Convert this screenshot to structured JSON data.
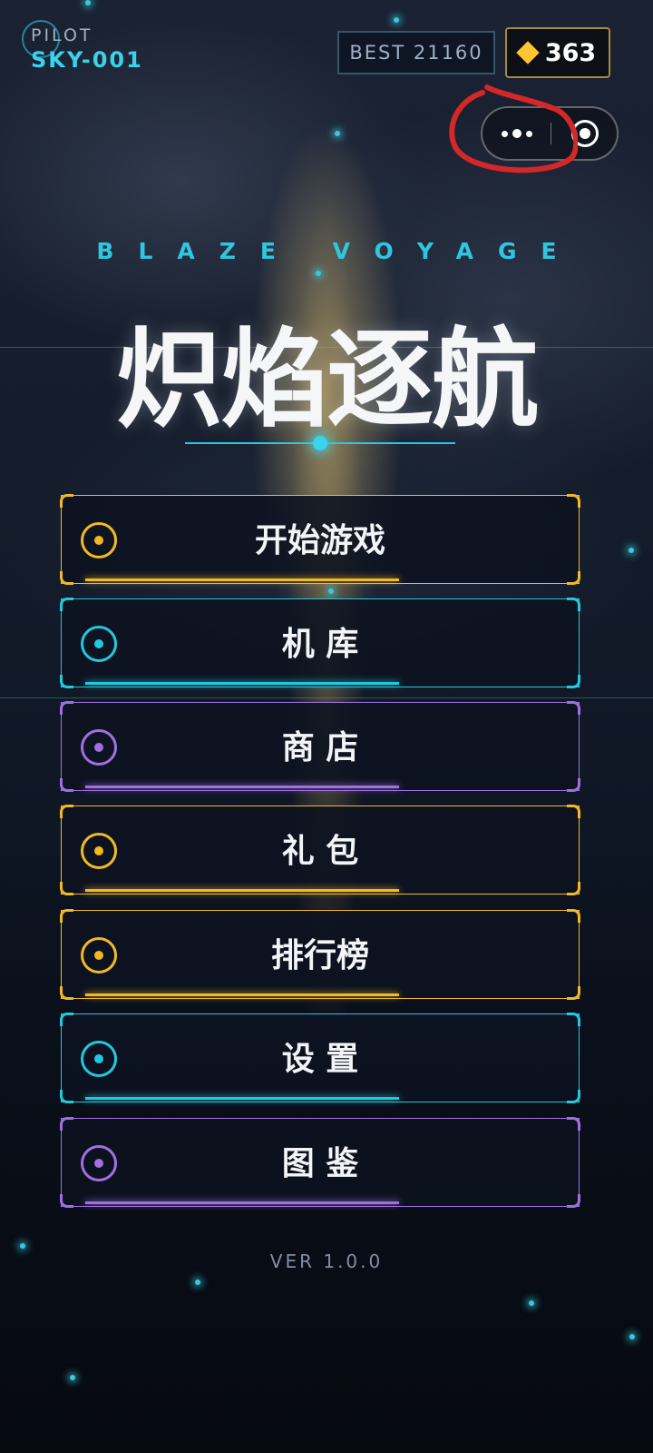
{
  "hud": {
    "pilot_label": "PILOT",
    "pilot_id": "SKY-001",
    "best": "BEST 21160",
    "coins": "363"
  },
  "capsule": {
    "more_icon": "more-dots-icon",
    "close_icon": "target-circle-icon"
  },
  "title": {
    "subtitle": "BLAZE VOYAGE",
    "main": "炽焰逐航"
  },
  "menu": [
    {
      "label": "开始游戏",
      "color": "#f2b925"
    },
    {
      "label": "机 库",
      "color": "#22c8dc"
    },
    {
      "label": "商 店",
      "color": "#a070e0"
    },
    {
      "label": "礼 包",
      "color": "#f2b925"
    },
    {
      "label": "排行榜",
      "color": "#f2b925"
    },
    {
      "label": "设 置",
      "color": "#22c8dc"
    },
    {
      "label": "图 鉴",
      "color": "#a070e0"
    }
  ],
  "version": "VER 1.0.0",
  "colors": {
    "accent": "#2ec6e0",
    "gold": "#f2b925",
    "annotation": "#d42828"
  }
}
